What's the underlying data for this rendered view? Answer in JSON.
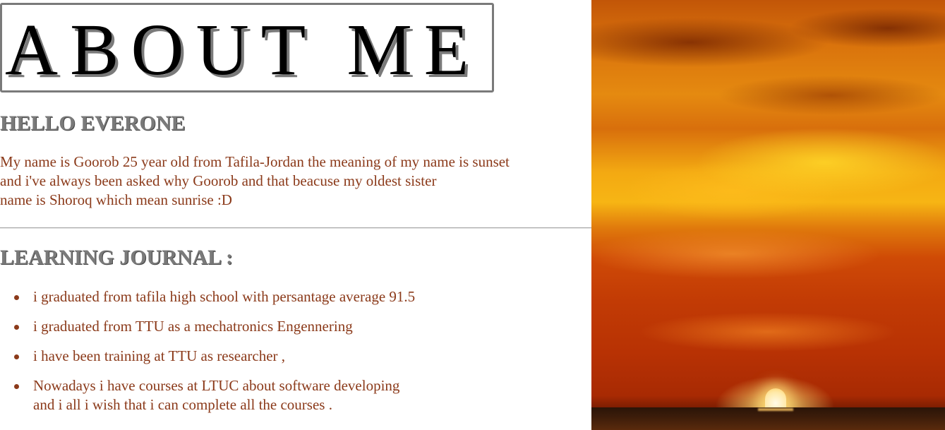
{
  "title": "ABOUT ME",
  "hello": {
    "heading": "HELLO EVERONE",
    "lines": [
      "My name is Goorob 25 year old from Tafila-Jordan the meaning of my name is sunset",
      "and i've always been asked why Goorob and that beacuse my oldest sister",
      "name is Shoroq which mean sunrise :D"
    ]
  },
  "journal": {
    "heading": "LEARNING JOURNAL :",
    "items": [
      {
        "lines": [
          "i graduated from tafila high school with persantage average 91.5"
        ]
      },
      {
        "lines": [
          "i graduated from TTU as a mechatronics Engennering"
        ]
      },
      {
        "lines": [
          "i have been training at TTU as researcher ,"
        ]
      },
      {
        "lines": [
          "Nowadays i have courses at LTUC about software developing",
          "and i all i wish that i can complete all the courses ."
        ]
      }
    ]
  },
  "colors": {
    "body_text": "#8b3a1a",
    "heading_gray": "#7a7a7a",
    "title_black": "#000000"
  }
}
